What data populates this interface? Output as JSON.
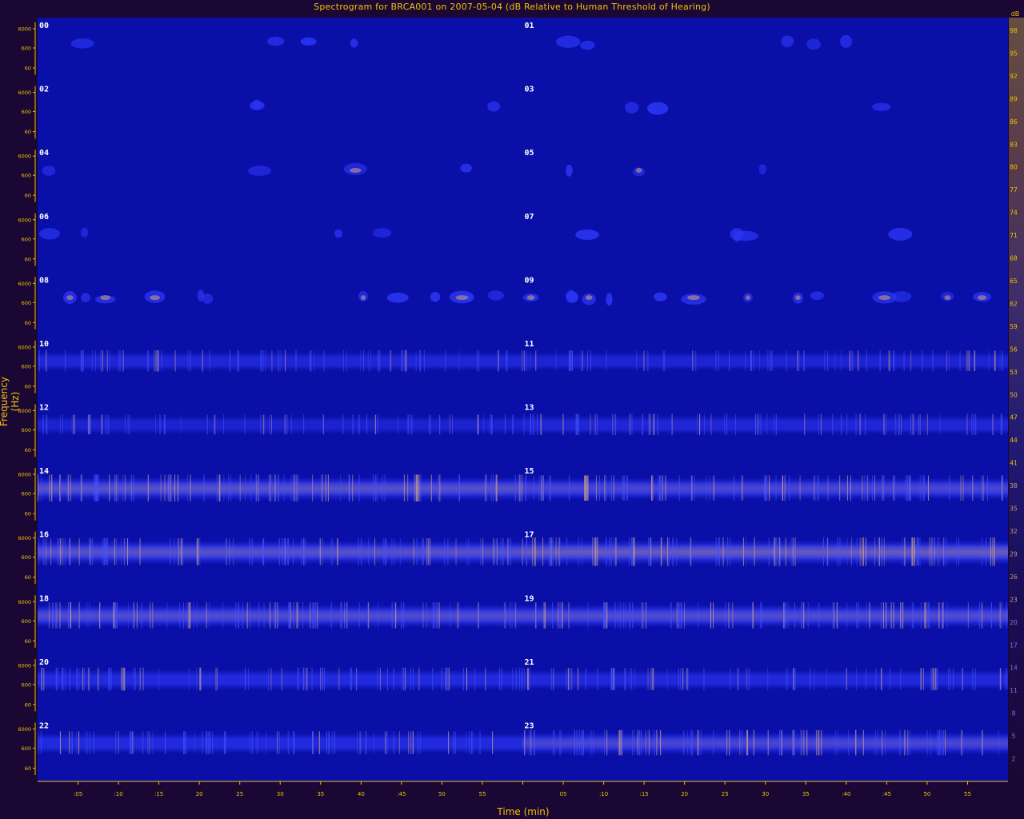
{
  "chart_data": {
    "type": "heatmap",
    "title": "Spectrogram for BRCA001 on 2007-05-04 (dB Relative to Human Threshold of Hearing)",
    "xlabel": "Time (min)",
    "ylabel": "Frequency (Hz)",
    "colorbar_unit": "dB",
    "hours": [
      "00",
      "01",
      "02",
      "03",
      "04",
      "05",
      "06",
      "07",
      "08",
      "09",
      "10",
      "11",
      "12",
      "13",
      "14",
      "15",
      "16",
      "17",
      "18",
      "19",
      "20",
      "21",
      "22",
      "23"
    ],
    "y_tick_labels": [
      "6000",
      "600",
      "60"
    ],
    "x_tick_labels": [
      ":05",
      ":10",
      ":15",
      "20",
      "25",
      "30",
      "35",
      "40",
      ":45",
      "50",
      "55",
      "",
      "05",
      ":10",
      ":15",
      "20",
      "25",
      "30",
      "35",
      ":40",
      ":45",
      "50",
      "55"
    ],
    "colorbar_ticks": [
      "98",
      "95",
      "92",
      "89",
      "86",
      "83",
      "80",
      "77",
      "74",
      "71",
      "68",
      "65",
      "62",
      "59",
      "56",
      "53",
      "50",
      "47",
      "44",
      "41",
      "38",
      "35",
      "32",
      "29",
      "26",
      "23",
      "20",
      "17",
      "14",
      "11",
      "8",
      "5",
      "2"
    ],
    "colorbar_range_db": [
      0,
      100
    ],
    "colors": {
      "background": "#1a0733",
      "spectrogram_base": "#0a0fa8",
      "low_energy": "#2a34f0",
      "high_energy": "#c89a7a",
      "axis": "#f2c200"
    },
    "hour_band_intensity": [
      0.05,
      0.08,
      0.03,
      0.03,
      0.04,
      0.03,
      0.05,
      0.07,
      0.25,
      0.3,
      0.5,
      0.45,
      0.4,
      0.5,
      0.85,
      0.75,
      0.85,
      0.95,
      0.8,
      0.8,
      0.6,
      0.55,
      0.6,
      0.75
    ]
  }
}
